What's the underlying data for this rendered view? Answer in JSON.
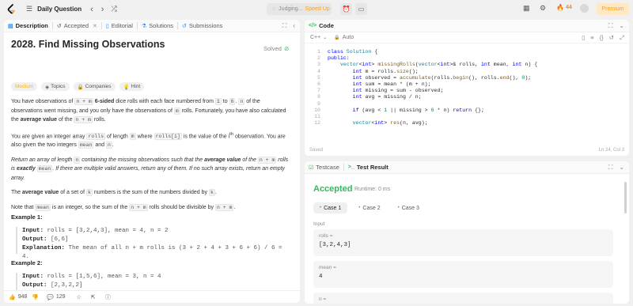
{
  "topbar": {
    "title": "Daily Question",
    "judging": "Judging...",
    "speed_up": "Speed Up",
    "streak": "44",
    "premium": "Premium"
  },
  "left": {
    "tabs": [
      "Description",
      "Accepted",
      "Editorial",
      "Solutions",
      "Submissions"
    ],
    "title": "2028. Find Missing Observations",
    "solved": "Solved",
    "badges": [
      "Medium",
      "Topics",
      "Companies",
      "Hint"
    ],
    "p1": {
      "t1": "You have observations of ",
      "c1": "n + m",
      "b1": "6-sided",
      "t2": " dice rolls with each face numbered from ",
      "c2": "1",
      "t3": " to ",
      "c3": "6",
      "t4": ". ",
      "c4": "n",
      "t5": " of the observations went missing, and you only have the observations of ",
      "c5": "m",
      "t6": " rolls. Fortunately, you have also calculated the ",
      "b2": "average value",
      "t7": " of the ",
      "c6": "n + m",
      "t8": " rolls."
    },
    "p2": {
      "t1": "You are given an integer array ",
      "c1": "rolls",
      "t2": " of length ",
      "c2": "m",
      "t3": " where ",
      "c3": "rolls[i]",
      "t4": " is the value of the ",
      "t5": "i",
      "t6": "th",
      "t7": " observation. You are also given the two integers ",
      "c4": "mean",
      "t8": " and ",
      "c5": "n",
      "t9": "."
    },
    "p3": {
      "t1": "Return an array of length ",
      "c1": "n",
      "t2": " containing the missing observations such that the ",
      "b1": "average value",
      "t3": " of the ",
      "c2": "n + m",
      "t4": " rolls is ",
      "b2": "exactly",
      "c3": "mean",
      "t5": ". If there are multiple valid answers, return any of them. If no such array exists, return an empty array."
    },
    "p4": {
      "t1": "The ",
      "b1": "average value",
      "t2": " of a set of ",
      "c1": "k",
      "t3": " numbers is the sum of the numbers divided by ",
      "c2": "k",
      "t4": "."
    },
    "p5": {
      "t1": "Note that ",
      "c1": "mean",
      "t2": " is an integer, so the sum of the ",
      "c2": "n + m",
      "t3": " rolls should be divisible by ",
      "c3": "n + m",
      "t4": "."
    },
    "ex1": {
      "title": "Example 1:",
      "input_k": "Input:",
      "input_v": " rolls = [3,2,4,3], mean = 4, n = 2",
      "output_k": "Output:",
      "output_v": " [6,6]",
      "expl_k": "Explanation:",
      "expl_v": " The mean of all n + m rolls is (3 + 2 + 4 + 3 + 6 + 6) / 6 = 4."
    },
    "ex2": {
      "title": "Example 2:",
      "input_k": "Input:",
      "input_v": " rolls = [1,5,6], mean = 3, n = 4",
      "output_k": "Output:",
      "output_v": " [2,3,2,2]"
    },
    "footer": {
      "likes": "948",
      "comments": "129"
    }
  },
  "code": {
    "tab": "Code",
    "lang": "C++",
    "mode": "Auto",
    "status": "Saved",
    "pos": "Ln 24, Col 3",
    "lines": [
      {
        "n": "1",
        "html": "<span class=\"kw\">class</span> <span class=\"ty\">Solution</span> {"
      },
      {
        "n": "2",
        "html": "<span class=\"kw\">public</span>:"
      },
      {
        "n": "3",
        "html": "    <span class=\"ty\">vector</span>&lt;<span class=\"kw\">int</span>&gt; <span class=\"fn\">missingRolls</span>(<span class=\"ty\">vector</span>&lt;<span class=\"kw\">int</span>&gt;&amp; rolls, <span class=\"kw\">int</span> mean, <span class=\"kw\">int</span> n) {"
      },
      {
        "n": "4",
        "html": "        <span class=\"kw\">int</span> m = rolls.<span class=\"fn\">size</span>();"
      },
      {
        "n": "5",
        "html": "        <span class=\"kw\">int</span> observed = <span class=\"fn\">accumulate</span>(rolls.<span class=\"fn\">begin</span>(), rolls.<span class=\"fn\">end</span>(), <span class=\"nm\">0</span>);"
      },
      {
        "n": "6",
        "html": "        <span class=\"kw\">int</span> sum = mean * (m + n);"
      },
      {
        "n": "7",
        "html": "        <span class=\"kw\">int</span> missing = sum - observed;"
      },
      {
        "n": "8",
        "html": "        <span class=\"kw\">int</span> avg = missing / n;"
      },
      {
        "n": "9",
        "html": ""
      },
      {
        "n": "10",
        "html": "        <span class=\"kw\">if</span> (avg &lt; <span class=\"nm\">1</span> || missing &gt; <span class=\"nm\">6</span> * n) <span class=\"kw\">return</span> {};"
      },
      {
        "n": "11",
        "html": ""
      },
      {
        "n": "12",
        "html": "        <span class=\"ty\">vector</span>&lt;<span class=\"kw\">int</span>&gt; <span class=\"fn\">res</span>(n, avg);"
      }
    ]
  },
  "test": {
    "tabs": [
      "Testcase",
      "Test Result"
    ],
    "accepted": "Accepted",
    "runtime": "Runtime: 0 ms",
    "cases": [
      "Case 1",
      "Case 2",
      "Case 3"
    ],
    "input_label": "Input",
    "vars": [
      {
        "name": "rolls =",
        "value": "[3,2,4,3]"
      },
      {
        "name": "mean =",
        "value": "4"
      },
      {
        "name": "n =",
        "value": ""
      }
    ]
  }
}
